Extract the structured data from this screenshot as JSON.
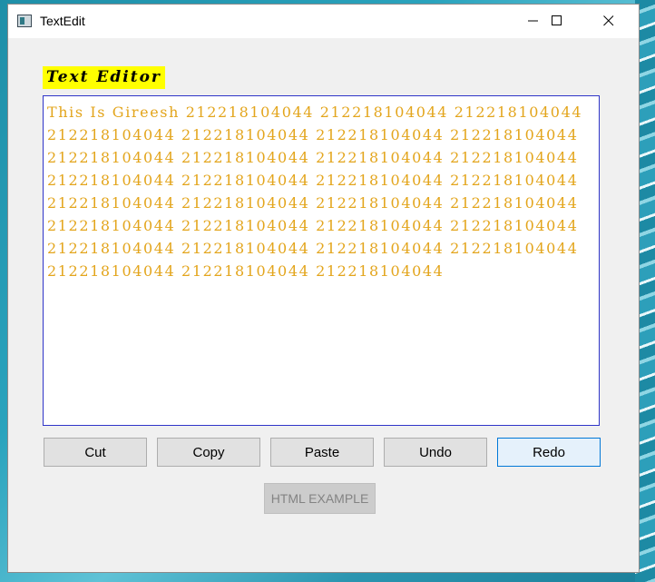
{
  "window": {
    "title": "TextEdit",
    "controls": [
      "minimize-icon",
      "maximize-icon",
      "close-icon"
    ]
  },
  "heading": {
    "text": "Text Editor",
    "background": "#ffff00"
  },
  "editor": {
    "text": "This Is Gireesh 212218104044 212218104044 212218104044 212218104044 212218104044 212218104044 212218104044 212218104044 212218104044 212218104044 212218104044 212218104044 212218104044 212218104044 212218104044 212218104044 212218104044 212218104044 212218104044 212218104044 212218104044 212218104044 212218104044 212218104044 212218104044 212218104044 212218104044 212218104044 212218104044 212218104044",
    "text_color": "#e3a51c",
    "border_color": "#2f35c8"
  },
  "buttons": {
    "cut": "Cut",
    "copy": "Copy",
    "paste": "Paste",
    "undo": "Undo",
    "redo": "Redo",
    "html_example": "HTML EXAMPLE"
  }
}
